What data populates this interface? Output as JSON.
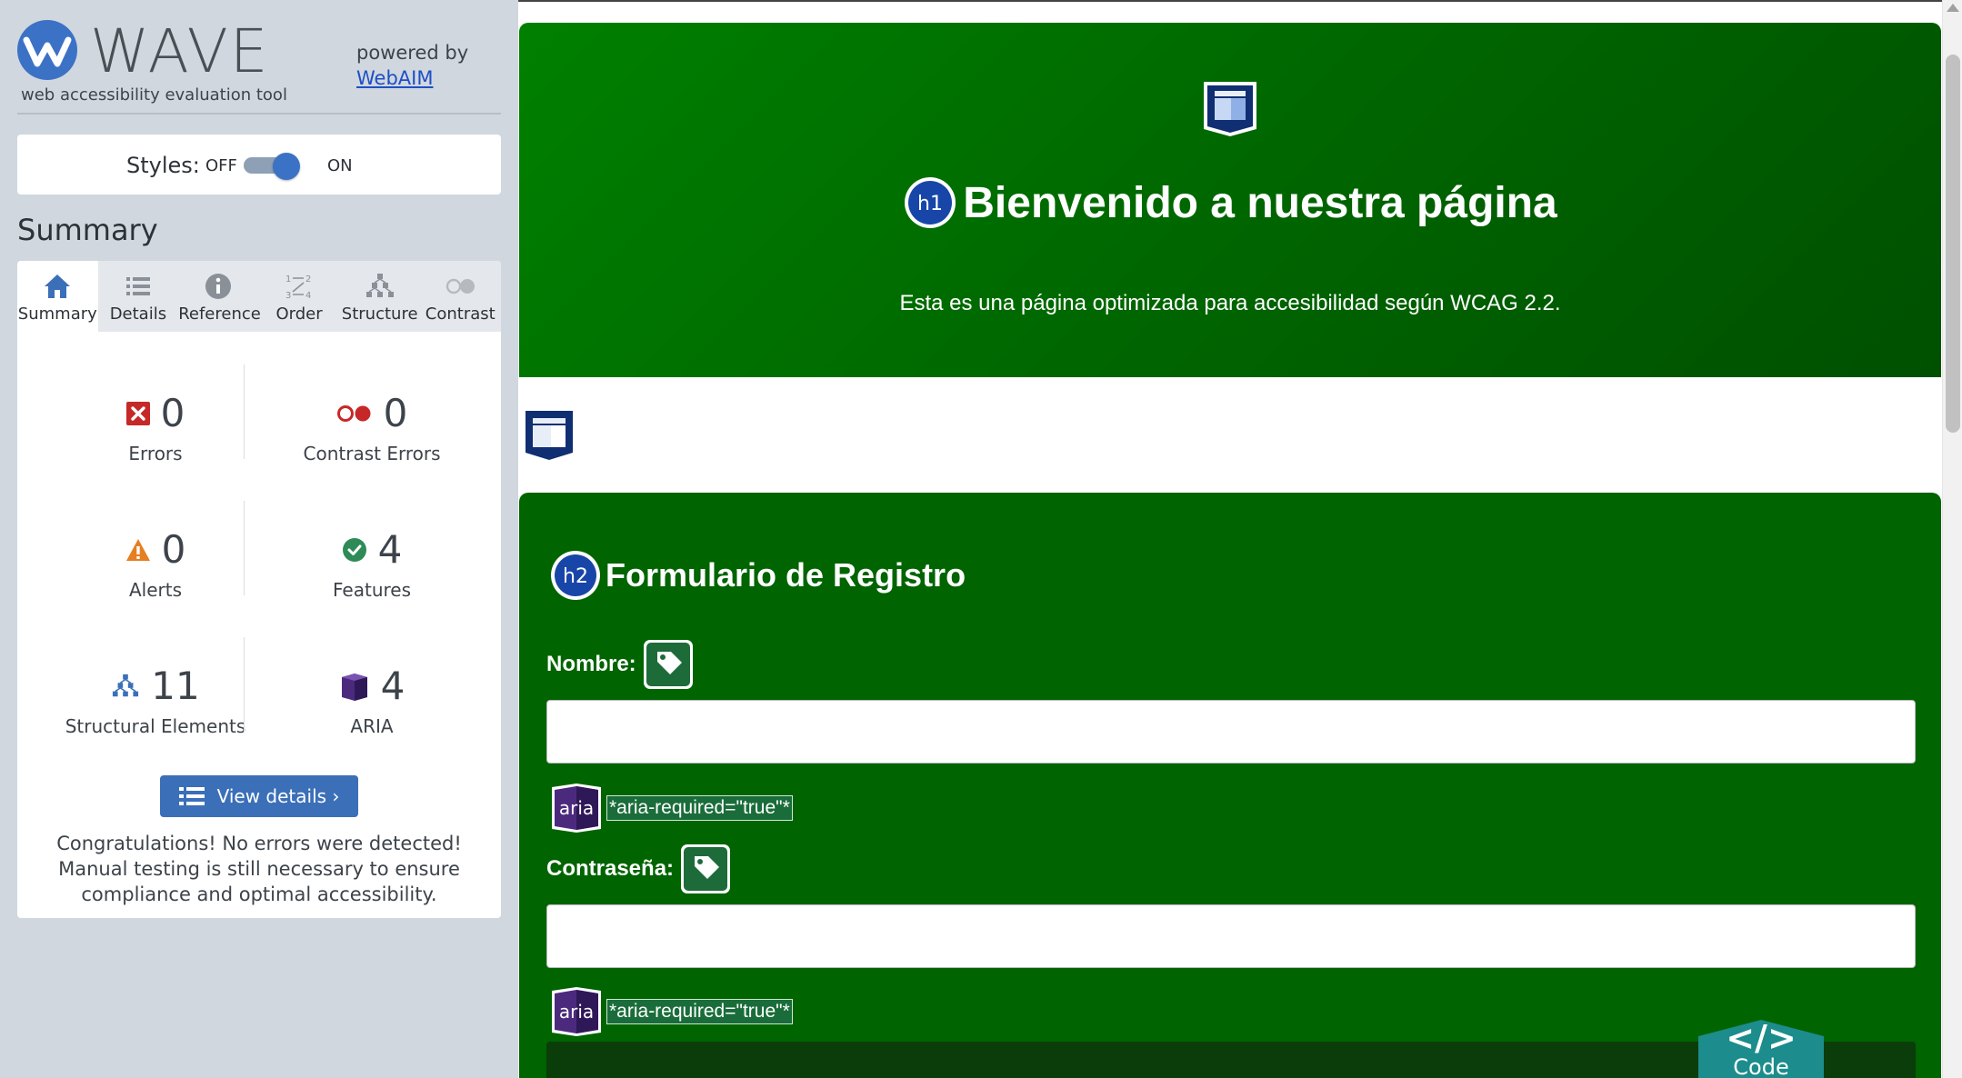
{
  "wave": {
    "logo_word": "WAVE",
    "tagline": "web accessibility evaluation tool",
    "powered_by": "powered by",
    "webaim_link": "WebAIM"
  },
  "styles": {
    "label": "Styles:",
    "off": "OFF",
    "on": "ON",
    "enabled": true
  },
  "summary_title": "Summary",
  "tabs": [
    {
      "label": "Summary",
      "icon": "home-icon",
      "active": true
    },
    {
      "label": "Details",
      "icon": "list-icon",
      "active": false
    },
    {
      "label": "Reference",
      "icon": "info-icon",
      "active": false
    },
    {
      "label": "Order",
      "icon": "order-icon",
      "active": false
    },
    {
      "label": "Structure",
      "icon": "structure-icon",
      "active": false
    },
    {
      "label": "Contrast",
      "icon": "contrast-icon",
      "active": false
    }
  ],
  "stats": {
    "errors": {
      "count": "0",
      "label": "Errors"
    },
    "contrast_errors": {
      "count": "0",
      "label": "Contrast Errors"
    },
    "alerts": {
      "count": "0",
      "label": "Alerts"
    },
    "features": {
      "count": "4",
      "label": "Features"
    },
    "structural": {
      "count": "11",
      "label": "Structural Elements"
    },
    "aria": {
      "count": "4",
      "label": "ARIA"
    }
  },
  "view_details": "View details ›",
  "congrats": "Congratulations! No errors were detected! Manual testing is still necessary to ensure compliance and optimal accessibility.",
  "page": {
    "h1_badge": "h1",
    "h1": "Bienvenido a nuestra página",
    "subtitle": "Esta es una página optimizada para accesibilidad según WCAG 2.2.",
    "h2_badge": "h2",
    "h2": "Formulario de Registro",
    "fields": [
      {
        "label": "Nombre:",
        "aria_badge": "aria",
        "aria_attr": "*aria-required=\"true\"*"
      },
      {
        "label": "Contraseña:",
        "aria_badge": "aria",
        "aria_attr": "*aria-required=\"true\"*"
      }
    ]
  },
  "code_button": {
    "glyph": "</>",
    "label": "Code"
  },
  "colors": {
    "wave_blue": "#3b72c6",
    "page_green": "#006400",
    "error_red": "#c0392b",
    "alert_orange": "#e67e22",
    "feature_green": "#2e8b57",
    "aria_purple": "#4b2a7e",
    "code_teal": "#1c8c8c"
  }
}
